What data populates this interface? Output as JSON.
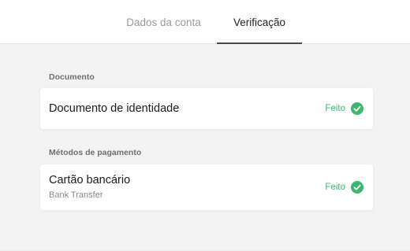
{
  "tabs": [
    {
      "label": "Dados da conta",
      "active": false
    },
    {
      "label": "Verificação",
      "active": true
    }
  ],
  "sections": [
    {
      "title": "Documento",
      "items": [
        {
          "title": "Documento de identidade",
          "subtitle": "",
          "status": "Feito",
          "status_icon": "check-circle-icon"
        }
      ]
    },
    {
      "title": "Métodos de pagamento",
      "items": [
        {
          "title": "Cartão bancário",
          "subtitle": "Bank Transfer",
          "status": "Feito",
          "status_icon": "check-circle-icon"
        }
      ]
    }
  ],
  "colors": {
    "success": "#3cb86e",
    "background": "#f3f3f3",
    "active_tab_underline": "#4a4a4a"
  }
}
